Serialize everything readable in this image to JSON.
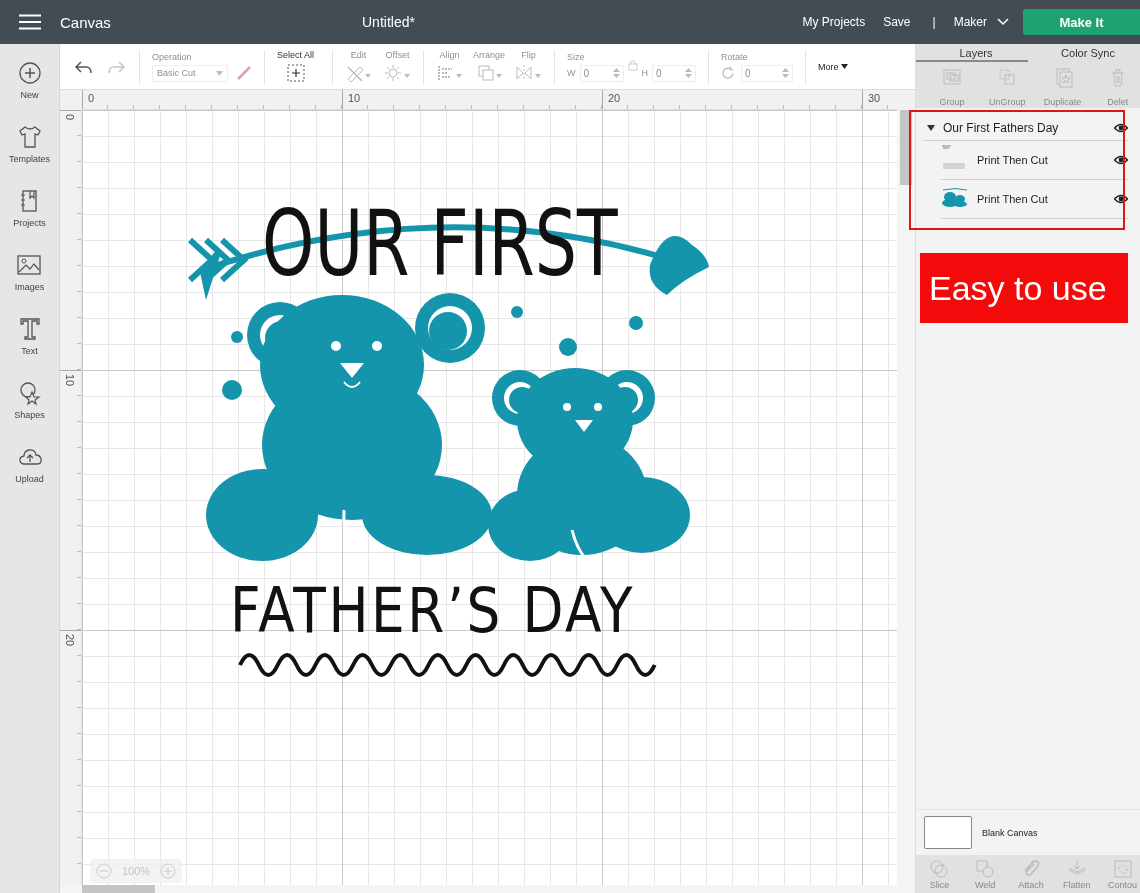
{
  "topbar": {
    "title": "Canvas",
    "document": "Untitled*",
    "links": [
      "My Projects",
      "Save"
    ],
    "separator": "|",
    "machine": "Maker",
    "action": "Make It"
  },
  "sidebar": {
    "items": [
      {
        "label": "New"
      },
      {
        "label": "Templates"
      },
      {
        "label": "Projects"
      },
      {
        "label": "Images"
      },
      {
        "label": "Text"
      },
      {
        "label": "Shapes"
      },
      {
        "label": "Upload"
      }
    ]
  },
  "toolbar": {
    "history": [
      {
        "kind": "undo",
        "disabled": false
      },
      {
        "kind": "redo",
        "disabled": true
      }
    ],
    "operation": {
      "label": "Operation",
      "value": "Basic Cut",
      "disabled": true
    },
    "tools": [
      {
        "label": "Select All",
        "disabled": false
      },
      {
        "label": "Edit",
        "disabled": true
      },
      {
        "label": "Offset",
        "disabled": true
      },
      {
        "label": "Align",
        "disabled": true
      },
      {
        "label": "Arrange",
        "disabled": true
      },
      {
        "label": "Flip",
        "disabled": true
      }
    ],
    "size": {
      "label": "Size",
      "disabled": true,
      "w_label": "W",
      "w_value": "0",
      "h_label": "H",
      "h_value": "0"
    },
    "rotate": {
      "label": "Rotate",
      "disabled": true,
      "value": "0"
    },
    "more": "More"
  },
  "rulers": {
    "x_labels": [
      "0",
      "10",
      "20",
      "30"
    ],
    "y_labels": [
      "0",
      "10",
      "20"
    ]
  },
  "design": {
    "line_1": "OUR FIRST",
    "line_2": "FATHER’S DAY"
  },
  "zoom": {
    "value": "100%",
    "disabled": true
  },
  "panel": {
    "tabs": [
      {
        "label": "Layers",
        "selected": true
      },
      {
        "label": "Color Sync",
        "selected": false
      }
    ],
    "actions": [
      {
        "label": "Group",
        "disabled": true
      },
      {
        "label": "UnGroup",
        "disabled": true
      },
      {
        "label": "Duplicate",
        "disabled": true
      },
      {
        "label": "Delet",
        "disabled": true
      }
    ],
    "layers": {
      "name": "Our First Fathers Day",
      "expanded": true,
      "visible": true,
      "children": [
        {
          "name": "Print Then Cut",
          "visible": true
        },
        {
          "name": "Print Then Cut",
          "visible": true
        }
      ]
    },
    "banner": "Easy to use",
    "canvas_label": "Blank Canvas",
    "bottom_actions": [
      {
        "label": "Slice",
        "disabled": true
      },
      {
        "label": "Weld",
        "disabled": true
      },
      {
        "label": "Attach",
        "disabled": true
      },
      {
        "label": "Flatten",
        "disabled": true
      },
      {
        "label": "Contou",
        "disabled": true
      }
    ]
  }
}
